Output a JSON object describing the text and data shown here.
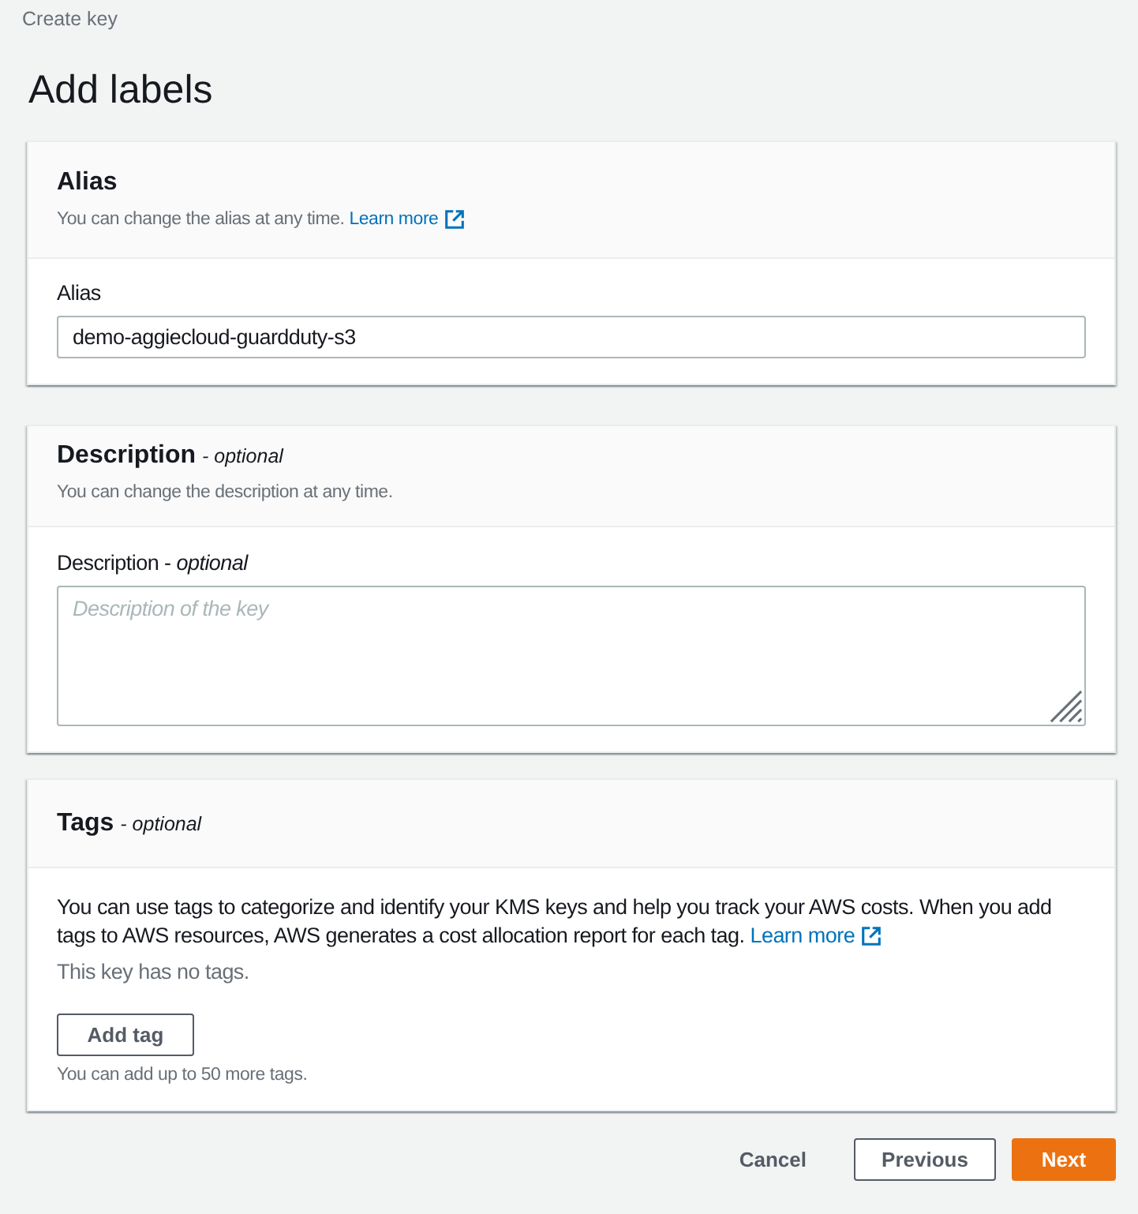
{
  "breadcrumb": [
    {
      "label": "Create key"
    }
  ],
  "page_title": "Add labels",
  "sections": [
    {
      "kind": "alias",
      "title": "Alias",
      "description": "You can change the alias at any time.",
      "link": "Learn more",
      "field": {
        "kind": "input",
        "label": "Alias",
        "value": "demo-aggiecloud-guardduty-s3"
      }
    },
    {
      "kind": "description",
      "title": "Description",
      "title_note": "- optional",
      "description": "You can change the description at any time.",
      "field": {
        "kind": "textarea",
        "label": "Description - *optional*",
        "placeholder": "Description of the key"
      }
    },
    {
      "kind": "tags",
      "title": "Tags",
      "title_note": "- optional",
      "text": "You can use tags to categorize and identify your KMS keys and help you track your AWS costs. When you add tags to AWS resources, AWS generates a cost allocation report for each tag.",
      "link": "Learn more",
      "empty_text": "This key has no tags.",
      "button": "Add tag",
      "hint": "You can add up to 50 more tags."
    }
  ],
  "footer_buttons": [
    {
      "kind": "link",
      "label": "Cancel"
    },
    {
      "kind": "secondary",
      "label": "Previous"
    },
    {
      "kind": "primary",
      "label": "Next"
    }
  ]
}
